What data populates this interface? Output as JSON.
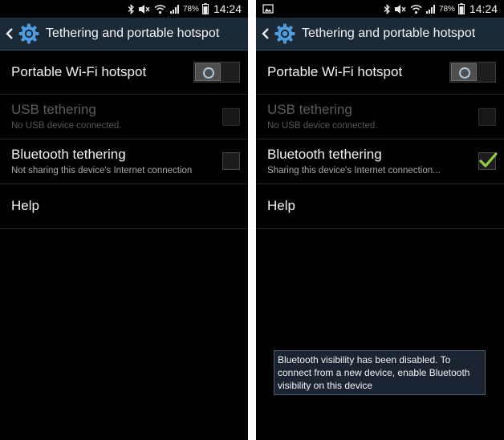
{
  "status": {
    "battery_percent": "78%",
    "time": "14:24"
  },
  "header": {
    "title": "Tethering and portable hotspot"
  },
  "settings": {
    "wifi_hotspot": {
      "label": "Portable Wi-Fi hotspot",
      "on": false
    },
    "usb_tethering": {
      "label": "USB tethering",
      "sub": "No USB device connected.",
      "enabled": false,
      "checked": false
    },
    "bluetooth_tethering": {
      "label": "Bluetooth tethering"
    },
    "help": {
      "label": "Help"
    }
  },
  "left_screen": {
    "bluetooth_sub": "Not sharing this device's Internet connection",
    "bluetooth_checked": false
  },
  "right_screen": {
    "bluetooth_sub": "Sharing this device's Internet connection...",
    "bluetooth_checked": true,
    "toast": "Bluetooth visibility has been disabled. To connect from a new device, enable Bluetooth visibility on this device"
  },
  "colors": {
    "action_bar": "#1c2a38",
    "accent_blue": "#4d9de0",
    "check_green": "#8fd13f"
  },
  "icons": {
    "status_bar": [
      "image-notification-icon",
      "bluetooth-icon",
      "mute-icon",
      "wifi-icon",
      "signal-icon",
      "battery-icon"
    ],
    "header": [
      "back-icon",
      "settings-gear-icon"
    ]
  }
}
